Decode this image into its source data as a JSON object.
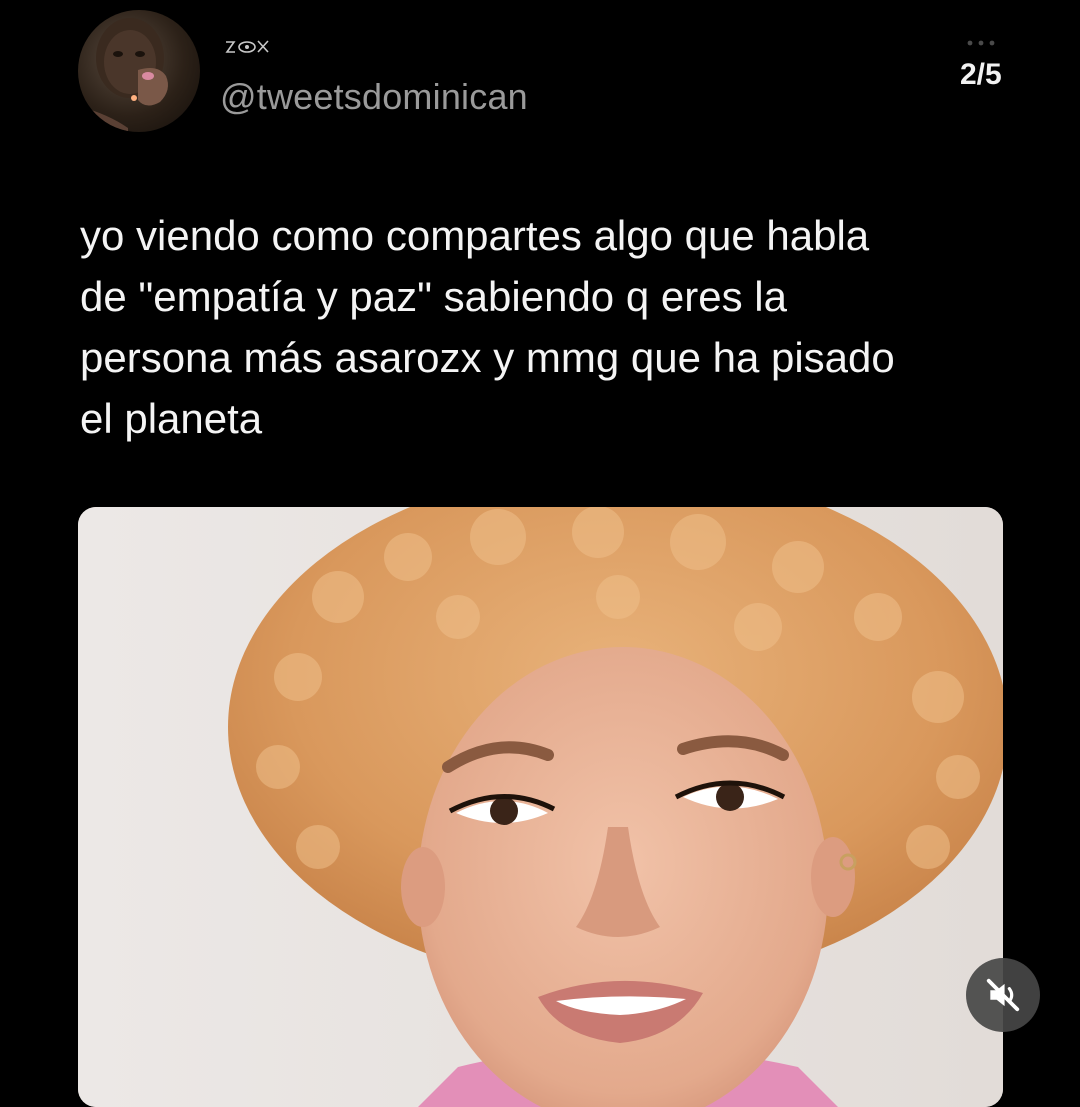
{
  "author": {
    "display_name_icon": "eye-glyph-icon",
    "handle": "@tweetsdominican",
    "avatar_icon": "profile-photo"
  },
  "pager": {
    "label": "2/5",
    "more_icon": "more-dots-icon"
  },
  "tweet": {
    "lines": [
      "yo viendo como compartes algo que habla",
      "de \"empatía y paz\" sabiendo q eres la",
      "persona más asarozx y mmg que ha pisado",
      "el planeta"
    ]
  },
  "media": {
    "kind": "video",
    "mute_icon": "muted-speaker-icon",
    "colors": {
      "background": "#e9e4e1",
      "hair": "#e0a063",
      "skin": "#e7b095",
      "shirt": "#e38fb8"
    }
  }
}
